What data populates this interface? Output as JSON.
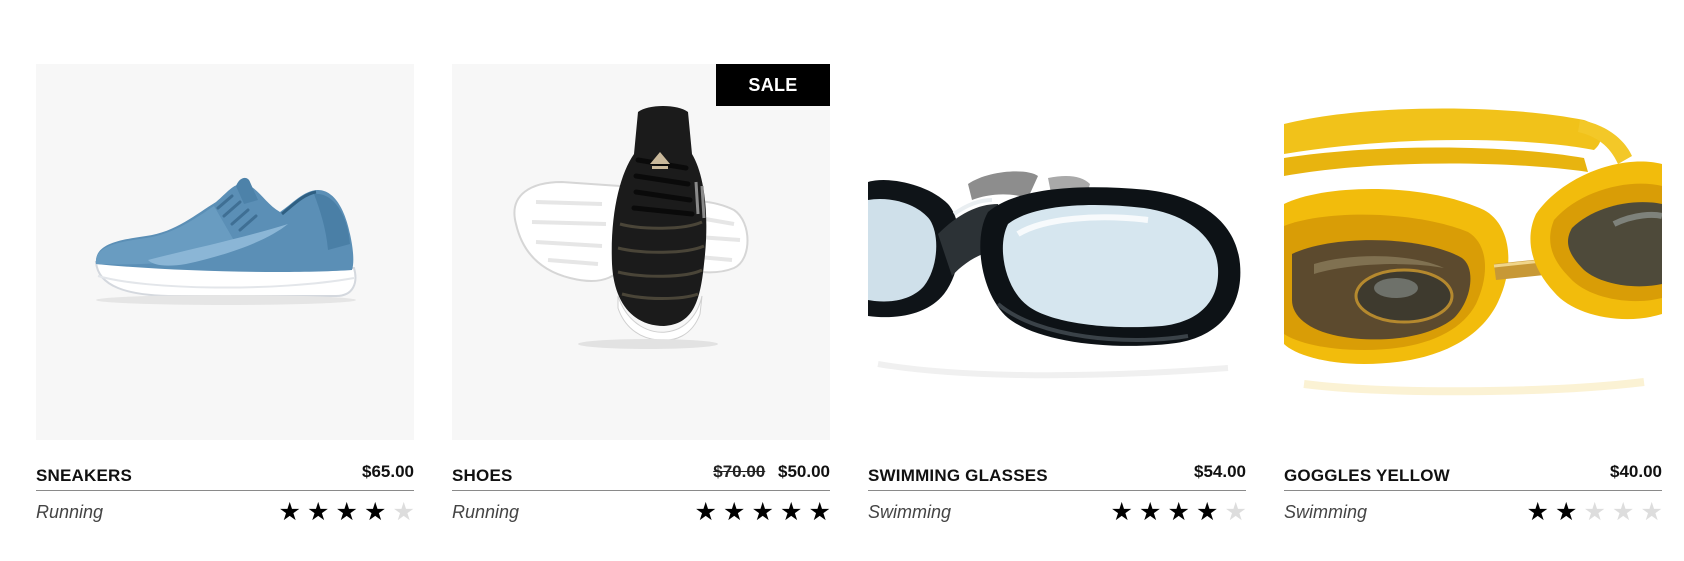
{
  "products": [
    {
      "name": "SNEAKERS",
      "category": "Running",
      "price": "$65.00",
      "old_price": "",
      "badge": "",
      "rating": 4,
      "rating_max": 5,
      "image": "blue-sneaker"
    },
    {
      "name": "SHOES",
      "category": "Running",
      "price": "$50.00",
      "old_price": "$70.00",
      "badge": "SALE",
      "rating": 5,
      "rating_max": 5,
      "image": "black-shoes"
    },
    {
      "name": "SWIMMING GLASSES",
      "category": "Swimming",
      "price": "$54.00",
      "old_price": "",
      "badge": "",
      "rating": 4,
      "rating_max": 5,
      "image": "black-swim-goggles"
    },
    {
      "name": "GOGGLES YELLOW",
      "category": "Swimming",
      "price": "$40.00",
      "old_price": "",
      "badge": "",
      "rating": 2,
      "rating_max": 5,
      "image": "yellow-goggles"
    }
  ],
  "colors": {
    "star_on": "#000000",
    "star_off": "#dddddd",
    "badge_bg": "#000000",
    "divider": "#8a8a8a"
  },
  "icons": {
    "star": "star-icon"
  }
}
